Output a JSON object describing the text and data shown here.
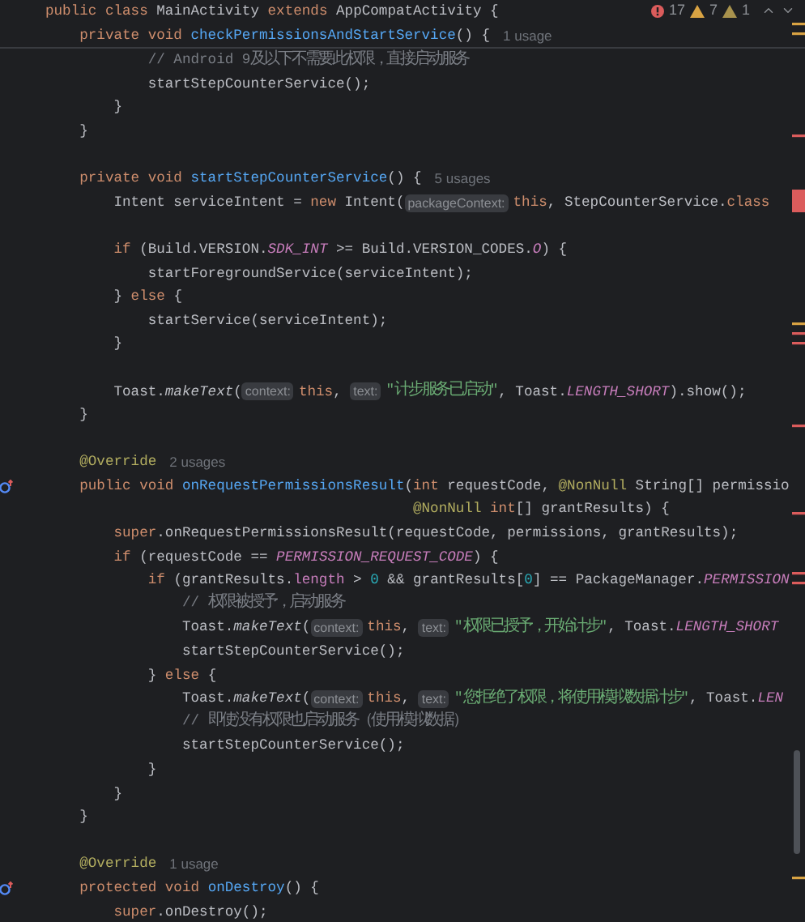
{
  "inspection_widget": {
    "errors": "17",
    "warnings": "7",
    "weak_warnings": "1"
  },
  "sticky_lines": [
    {
      "kind": "code",
      "tokens": [
        {
          "kind": "keyword",
          "text": "public class "
        },
        {
          "kind": "plain",
          "text": "MainActivity "
        },
        {
          "kind": "keyword",
          "text": "extends "
        },
        {
          "kind": "plain",
          "text": "AppCompatActivity {"
        }
      ]
    },
    {
      "kind": "code",
      "tokens": [
        {
          "kind": "keyword",
          "text": "    private void "
        },
        {
          "kind": "method",
          "text": "checkPermissionsAndStartService"
        },
        {
          "kind": "plain",
          "text": "() {"
        },
        {
          "kind": "usage",
          "text": "1 usage"
        }
      ]
    }
  ],
  "lines": [
    {
      "kind": "code",
      "tokens": [
        {
          "kind": "comment",
          "text": "            // Android 9及以下不需要此权限，直接启动服务"
        }
      ]
    },
    {
      "kind": "code",
      "tokens": [
        {
          "kind": "plain",
          "text": "            startStepCounterService();"
        }
      ]
    },
    {
      "kind": "code",
      "tokens": [
        {
          "kind": "plain",
          "text": "        }"
        }
      ]
    },
    {
      "kind": "code",
      "tokens": [
        {
          "kind": "plain",
          "text": "    }"
        }
      ]
    },
    {
      "kind": "blank"
    },
    {
      "kind": "code",
      "tokens": [
        {
          "kind": "keyword",
          "text": "    private void "
        },
        {
          "kind": "method",
          "text": "startStepCounterService"
        },
        {
          "kind": "plain",
          "text": "() {"
        },
        {
          "kind": "usage",
          "text": "5 usages"
        }
      ]
    },
    {
      "kind": "code",
      "tokens": [
        {
          "kind": "plain",
          "text": "        Intent serviceIntent = "
        },
        {
          "kind": "keyword",
          "text": "new "
        },
        {
          "kind": "plain",
          "text": "Intent("
        },
        {
          "kind": "hint",
          "text": "packageContext:"
        },
        {
          "kind": "keyword",
          "text": "this"
        },
        {
          "kind": "plain",
          "text": ", StepCounterService."
        },
        {
          "kind": "keyword",
          "text": "class"
        }
      ]
    },
    {
      "kind": "blank"
    },
    {
      "kind": "code",
      "tokens": [
        {
          "kind": "keyword",
          "text": "        if "
        },
        {
          "kind": "plain",
          "text": "(Build.VERSION."
        },
        {
          "kind": "constant",
          "text": "SDK_INT"
        },
        {
          "kind": "plain",
          "text": " >= Build.VERSION_CODES."
        },
        {
          "kind": "constant",
          "text": "O"
        },
        {
          "kind": "plain",
          "text": ") {"
        }
      ]
    },
    {
      "kind": "code",
      "tokens": [
        {
          "kind": "plain",
          "text": "            startForegroundService(serviceIntent);"
        }
      ]
    },
    {
      "kind": "code",
      "tokens": [
        {
          "kind": "plain",
          "text": "        } "
        },
        {
          "kind": "keyword",
          "text": "else "
        },
        {
          "kind": "plain",
          "text": "{"
        }
      ]
    },
    {
      "kind": "code",
      "tokens": [
        {
          "kind": "plain",
          "text": "            startService(serviceIntent);"
        }
      ]
    },
    {
      "kind": "code",
      "tokens": [
        {
          "kind": "plain",
          "text": "        }"
        }
      ]
    },
    {
      "kind": "blank"
    },
    {
      "kind": "code",
      "tokens": [
        {
          "kind": "plain",
          "text": "        Toast."
        },
        {
          "kind": "static",
          "text": "makeText"
        },
        {
          "kind": "plain",
          "text": "("
        },
        {
          "kind": "hint",
          "text": "context:"
        },
        {
          "kind": "keyword",
          "text": "this"
        },
        {
          "kind": "plain",
          "text": ", "
        },
        {
          "kind": "hint",
          "text": "text:"
        },
        {
          "kind": "string",
          "text": "\"计步服务已启动\""
        },
        {
          "kind": "plain",
          "text": ", Toast."
        },
        {
          "kind": "constant",
          "text": "LENGTH_SHORT"
        },
        {
          "kind": "plain",
          "text": ").show();"
        }
      ]
    },
    {
      "kind": "code",
      "tokens": [
        {
          "kind": "plain",
          "text": "    }"
        }
      ]
    },
    {
      "kind": "blank"
    },
    {
      "kind": "code",
      "tokens": [
        {
          "kind": "annotation",
          "text": "    @Override"
        },
        {
          "kind": "usage",
          "text": "2 usages"
        }
      ]
    },
    {
      "kind": "code",
      "override_marker": true,
      "tokens": [
        {
          "kind": "keyword",
          "text": "    public void "
        },
        {
          "kind": "method",
          "text": "onRequestPermissionsResult"
        },
        {
          "kind": "plain",
          "text": "("
        },
        {
          "kind": "keyword",
          "text": "int "
        },
        {
          "kind": "plain",
          "text": "requestCode, "
        },
        {
          "kind": "annotation",
          "text": "@NonNull "
        },
        {
          "kind": "plain",
          "text": "String[] permissio"
        }
      ]
    },
    {
      "kind": "code",
      "tokens": [
        {
          "kind": "annotation",
          "text": "                                           @NonNull "
        },
        {
          "kind": "keyword",
          "text": "int"
        },
        {
          "kind": "plain",
          "text": "[] grantResults) {"
        }
      ]
    },
    {
      "kind": "code",
      "tokens": [
        {
          "kind": "keyword",
          "text": "        super"
        },
        {
          "kind": "plain",
          "text": ".onRequestPermissionsResult(requestCode, permissions, grantResults);"
        }
      ]
    },
    {
      "kind": "code",
      "tokens": [
        {
          "kind": "keyword",
          "text": "        if "
        },
        {
          "kind": "plain",
          "text": "(requestCode == "
        },
        {
          "kind": "constant",
          "text": "PERMISSION_REQUEST_CODE"
        },
        {
          "kind": "plain",
          "text": ") {"
        }
      ]
    },
    {
      "kind": "code",
      "tokens": [
        {
          "kind": "keyword",
          "text": "            if "
        },
        {
          "kind": "plain",
          "text": "(grantResults."
        },
        {
          "kind": "field",
          "text": "length"
        },
        {
          "kind": "plain",
          "text": " > "
        },
        {
          "kind": "number",
          "text": "0"
        },
        {
          "kind": "plain",
          "text": " && grantResults["
        },
        {
          "kind": "number",
          "text": "0"
        },
        {
          "kind": "plain",
          "text": "] == PackageManager."
        },
        {
          "kind": "constant",
          "text": "PERMISSION"
        }
      ]
    },
    {
      "kind": "code",
      "tokens": [
        {
          "kind": "comment",
          "text": "                // 权限被授予，启动服务"
        }
      ]
    },
    {
      "kind": "code",
      "tokens": [
        {
          "kind": "plain",
          "text": "                Toast."
        },
        {
          "kind": "static",
          "text": "makeText"
        },
        {
          "kind": "plain",
          "text": "("
        },
        {
          "kind": "hint",
          "text": "context:"
        },
        {
          "kind": "keyword",
          "text": "this"
        },
        {
          "kind": "plain",
          "text": ", "
        },
        {
          "kind": "hint",
          "text": "text:"
        },
        {
          "kind": "string",
          "text": "\"权限已授予，开始计步\""
        },
        {
          "kind": "plain",
          "text": ", Toast."
        },
        {
          "kind": "constant",
          "text": "LENGTH_SHORT"
        }
      ]
    },
    {
      "kind": "code",
      "tokens": [
        {
          "kind": "plain",
          "text": "                startStepCounterService();"
        }
      ]
    },
    {
      "kind": "code",
      "tokens": [
        {
          "kind": "plain",
          "text": "            } "
        },
        {
          "kind": "keyword",
          "text": "else "
        },
        {
          "kind": "plain",
          "text": "{"
        }
      ]
    },
    {
      "kind": "code",
      "tokens": [
        {
          "kind": "plain",
          "text": "                Toast."
        },
        {
          "kind": "static",
          "text": "makeText"
        },
        {
          "kind": "plain",
          "text": "("
        },
        {
          "kind": "hint",
          "text": "context:"
        },
        {
          "kind": "keyword",
          "text": "this"
        },
        {
          "kind": "plain",
          "text": ", "
        },
        {
          "kind": "hint",
          "text": "text:"
        },
        {
          "kind": "string",
          "text": "\"您拒绝了权限，将使用模拟数据计步\""
        },
        {
          "kind": "plain",
          "text": ", Toast."
        },
        {
          "kind": "constant",
          "text": "LEN"
        }
      ]
    },
    {
      "kind": "code",
      "tokens": [
        {
          "kind": "comment",
          "text": "                // 即使没有权限也启动服务（使用模拟数据）"
        }
      ]
    },
    {
      "kind": "code",
      "tokens": [
        {
          "kind": "plain",
          "text": "                startStepCounterService();"
        }
      ]
    },
    {
      "kind": "code",
      "tokens": [
        {
          "kind": "plain",
          "text": "            }"
        }
      ]
    },
    {
      "kind": "code",
      "tokens": [
        {
          "kind": "plain",
          "text": "        }"
        }
      ]
    },
    {
      "kind": "code",
      "tokens": [
        {
          "kind": "plain",
          "text": "    }"
        }
      ]
    },
    {
      "kind": "blank"
    },
    {
      "kind": "code",
      "tokens": [
        {
          "kind": "annotation",
          "text": "    @Override"
        },
        {
          "kind": "usage",
          "text": "1 usage"
        }
      ]
    },
    {
      "kind": "code",
      "override_marker": true,
      "tokens": [
        {
          "kind": "keyword",
          "text": "    protected void "
        },
        {
          "kind": "method",
          "text": "onDestroy"
        },
        {
          "kind": "plain",
          "text": "() {"
        }
      ]
    },
    {
      "kind": "code",
      "tokens": [
        {
          "kind": "keyword",
          "text": "        super"
        },
        {
          "kind": "plain",
          "text": ".onDestroy();"
        }
      ]
    }
  ]
}
